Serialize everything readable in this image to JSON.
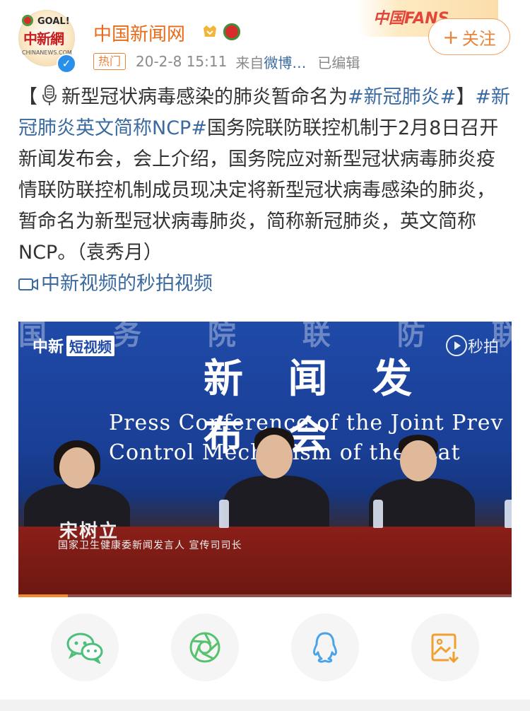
{
  "header": {
    "username": "中国新闻网",
    "avatar": {
      "logo_text": "中新網",
      "logo_goal": "GOAL!",
      "logo_sub": "CHINANEWS.COM"
    },
    "hot_tag": "热门",
    "time": "20-2-8 15:11",
    "source_prefix": "来自",
    "source_name": "微博…",
    "edited": "已编辑",
    "fans_banner": "中国FANS",
    "follow_label": "关注",
    "follow_plus": "+"
  },
  "post": {
    "bracket_open": "【",
    "title_text": "新型冠状病毒感染的肺炎暂命名为",
    "tag1": "#新冠肺炎#",
    "bracket_close": "】",
    "tag2": "#新冠肺炎英文简称NCP#",
    "body": "国务院联防联控机制于2月8日召开新闻发布会，会上介绍，国务院应对新型冠状病毒肺炎疫情联防联控机制成员现决定将新型冠状病毒感染的肺炎，暂命名为新型冠状病毒肺炎，简称新冠肺炎，英文简称NCP。（袁秀月）",
    "video_link": "中新视频的秒拍视频"
  },
  "video": {
    "watermark": "中新",
    "watermark_box": "短视频",
    "platform": "秒拍",
    "banner_cn": "新 闻 发 布 会",
    "banner_cn_top": "国 务 院 联 防 联 控",
    "banner_en_1": "Press Conference of the Joint Prev",
    "banner_en_2": "Control Mechanism of the Stat",
    "caption_name": "宋树立",
    "caption_role": "国家卫生健康委新闻发言人  宣传司司长",
    "progress": 0.1
  },
  "share": {
    "items": [
      {
        "name": "wechat",
        "color": "#4cbf7a"
      },
      {
        "name": "moments",
        "color": "#57c26e"
      },
      {
        "name": "qq",
        "color": "#4aa3e8"
      },
      {
        "name": "save-image",
        "color": "#f0a030"
      }
    ]
  },
  "colors": {
    "accent_orange": "#e8833a",
    "link_blue": "#3a6a9f"
  }
}
